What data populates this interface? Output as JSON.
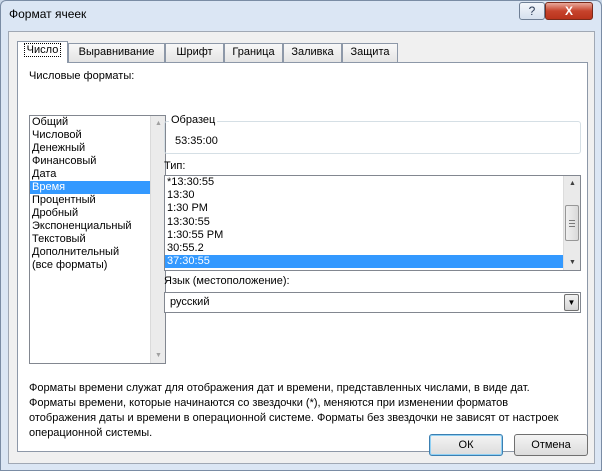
{
  "window": {
    "title": "Формат ячеек",
    "help_label": "?",
    "close_label": "X"
  },
  "tabs": [
    {
      "label": "Число",
      "active": true
    },
    {
      "label": "Выравнивание",
      "active": false
    },
    {
      "label": "Шрифт",
      "active": false
    },
    {
      "label": "Граница",
      "active": false
    },
    {
      "label": "Заливка",
      "active": false
    },
    {
      "label": "Защита",
      "active": false
    }
  ],
  "formats": {
    "label": "Числовые форматы:",
    "items": [
      "Общий",
      "Числовой",
      "Денежный",
      "Финансовый",
      "Дата",
      "Время",
      "Процентный",
      "Дробный",
      "Экспоненциальный",
      "Текстовый",
      "Дополнительный",
      "(все форматы)"
    ],
    "selected": "Время"
  },
  "sample": {
    "label": "Образец",
    "value": "53:35:00"
  },
  "type": {
    "label": "Тип:",
    "items": [
      "*13:30:55",
      "13:30",
      "1:30 PM",
      "13:30:55",
      "1:30:55 PM",
      "30:55.2",
      "37:30:55"
    ],
    "selected": "37:30:55"
  },
  "locale": {
    "label": "Язык (местоположение):",
    "value": "русский"
  },
  "description": "Форматы времени служат для отображения дат и времени, представленных числами, в виде дат. Форматы времени, которые начинаются со звездочки (*), меняются при изменении форматов отображения даты и времени в операционной системе. Форматы без звездочки не зависят от настроек операционной системы.",
  "buttons": {
    "ok": "ОК",
    "cancel": "Отмена"
  },
  "colors": {
    "selection": "#3399ff",
    "close_button": "#c7432c"
  }
}
